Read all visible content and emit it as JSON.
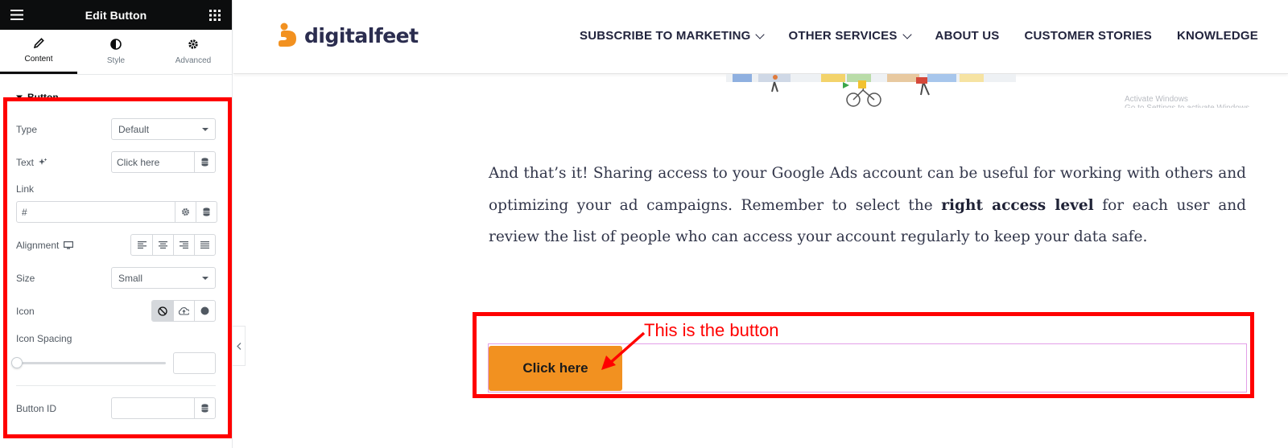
{
  "panel": {
    "title": "Edit Button",
    "tabs": [
      {
        "label": "Content",
        "icon": "pencil-icon"
      },
      {
        "label": "Style",
        "icon": "contrast-icon"
      },
      {
        "label": "Advanced",
        "icon": "gear-icon"
      }
    ],
    "section_title": "Button",
    "type": {
      "label": "Type",
      "value": "Default"
    },
    "text": {
      "label": "Text",
      "value": "Click here"
    },
    "link": {
      "label": "Link",
      "value": "#"
    },
    "alignment": {
      "label": "Alignment"
    },
    "size": {
      "label": "Size",
      "value": "Small"
    },
    "icon": {
      "label": "Icon"
    },
    "icon_spacing": {
      "label": "Icon Spacing",
      "value": ""
    },
    "button_id": {
      "label": "Button ID",
      "value": ""
    }
  },
  "site": {
    "logo_text": "digitalfeet",
    "nav": [
      {
        "label": "SUBSCRIBE TO MARKETING",
        "dropdown": true
      },
      {
        "label": "OTHER SERVICES",
        "dropdown": true
      },
      {
        "label": "ABOUT US",
        "dropdown": false
      },
      {
        "label": "CUSTOMER STORIES",
        "dropdown": false
      },
      {
        "label": "KNOWLEDGE",
        "dropdown": false
      }
    ],
    "watermark_line1": "Activate Windows",
    "watermark_line2": "Go to Settings to activate Windows.",
    "article_before": "And that’s it! Sharing access to your Google Ads account can be useful for working with others and optimizing your ad campaigns. Remember to select the ",
    "article_bold": "right access level",
    "article_after": " for each user and review the list of people who can access your account regularly to keep your data safe.",
    "button_label": "Click here",
    "annotation": "This is the button"
  },
  "colors": {
    "brand_orange": "#f29120",
    "annotation_red": "#ff0000",
    "panel_header": "#0c0d0e",
    "nav_text": "#22243d"
  }
}
